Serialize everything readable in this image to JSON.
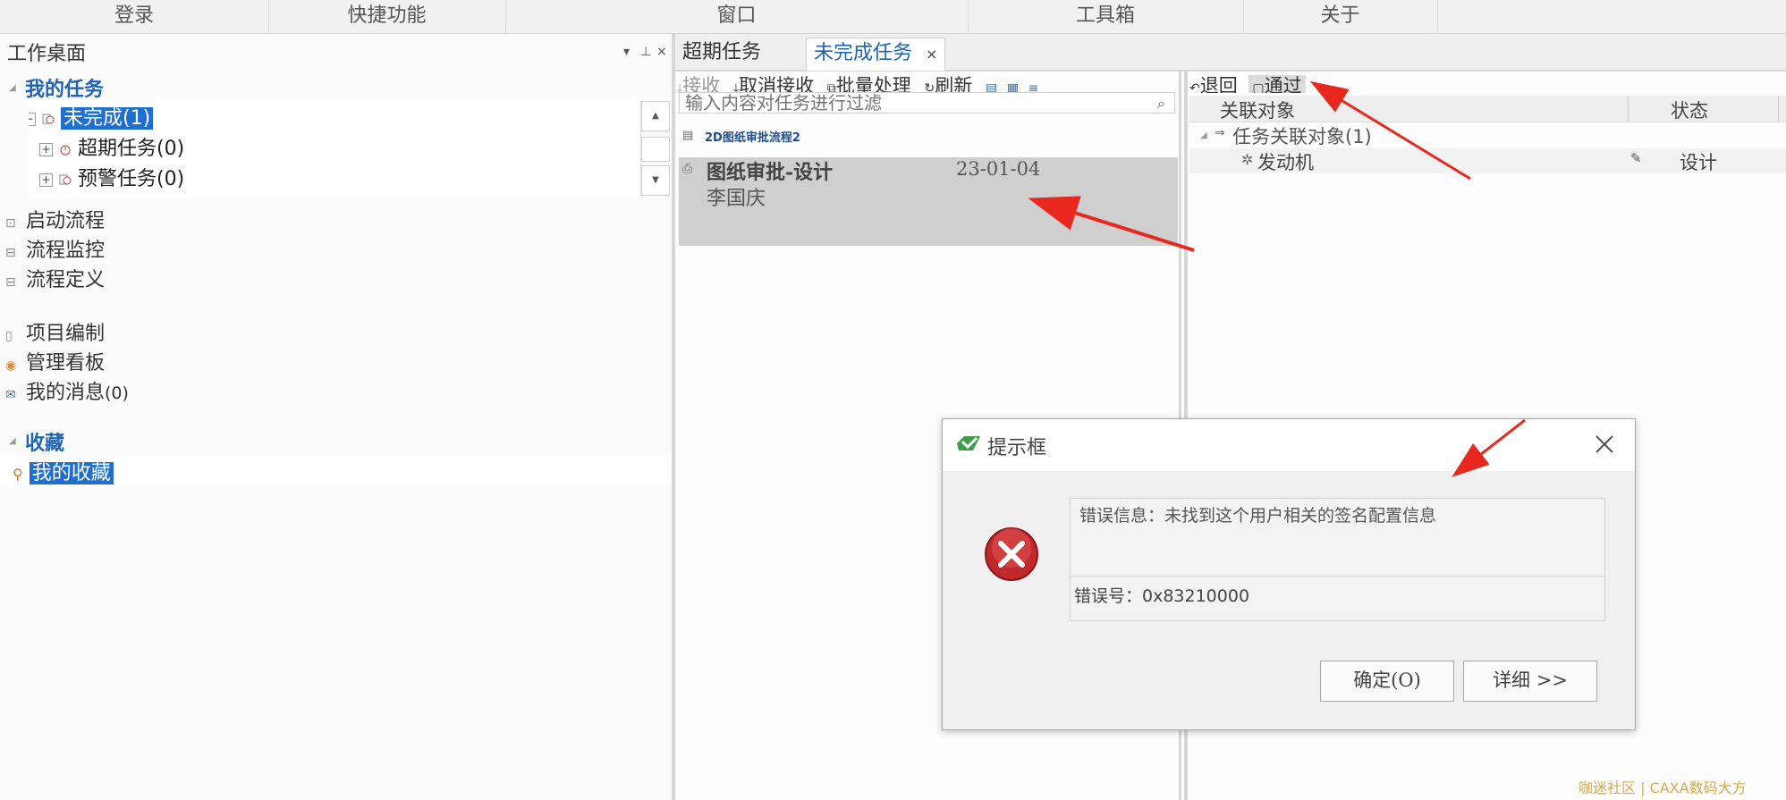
{
  "menubar": {
    "items": [
      "登录",
      "快捷功能",
      "窗口",
      "工具箱",
      "关于"
    ]
  },
  "left_panel": {
    "title": "工作桌面",
    "my_tasks": {
      "title": "我的任务",
      "tree": [
        {
          "label": "未完成(1)",
          "selected": true
        },
        {
          "label": "超期任务(0)",
          "selected": false
        },
        {
          "label": "预警任务(0)",
          "selected": false
        }
      ]
    },
    "nav_group1": [
      "启动流程",
      "流程监控",
      "流程定义"
    ],
    "nav_group2": [
      "项目编制",
      "管理看板"
    ],
    "messages": {
      "label": "我的消息",
      "count": "(0)"
    },
    "favorites": {
      "title": "收藏",
      "item": "我的收藏"
    }
  },
  "tabs": {
    "overdue": "超期任务",
    "incomplete": "未完成任务",
    "close_glyph": "×"
  },
  "mid_toolbar": {
    "receive": "接收",
    "cancel_receive": "取消接收",
    "batch": "批量处理",
    "refresh": "刷新"
  },
  "filter": {
    "placeholder": "输入内容对任务进行过滤"
  },
  "flow_group": "2D图纸审批流程2",
  "task": {
    "title": "图纸审批-设计",
    "date": "23-01-04",
    "person": "李国庆"
  },
  "right_toolbar": {
    "return": "退回",
    "pass": "通过"
  },
  "grid": {
    "headers": [
      "关联对象",
      "状态"
    ],
    "group": "任务关联对象(1)",
    "rows": [
      {
        "object": "发动机",
        "status": "设计"
      }
    ]
  },
  "dialog": {
    "title": "提示框",
    "error_message": "错误信息：未找到这个用户相关的签名配置信息",
    "error_code": "错误号：0x83210000",
    "ok_button": "确定(O)",
    "detail_button": "详细 >>"
  },
  "watermark": "咖迷社区 | CAXA数码大方",
  "colors": {
    "accent": "#1f63b3",
    "selection": "#1e6fcf",
    "arrow": "#e8281e",
    "error_red": "#c0282a"
  }
}
